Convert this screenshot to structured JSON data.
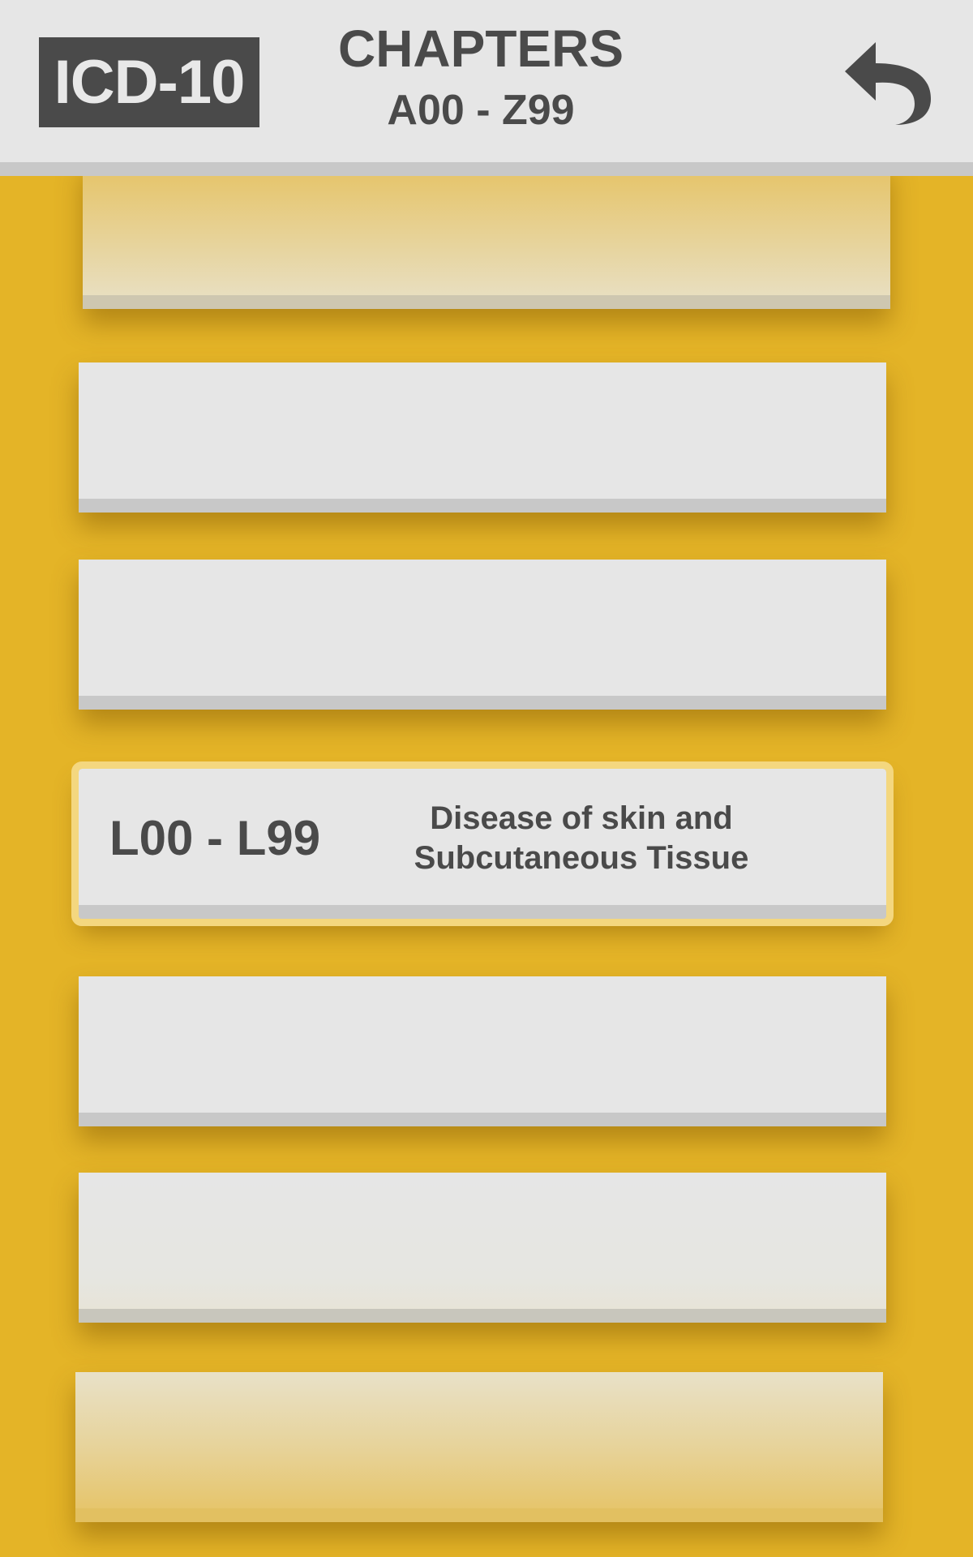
{
  "header": {
    "logo": "ICD-10",
    "title": "CHAPTERS",
    "subtitle": "A00 - Z99",
    "back_icon": "undo-arrow-icon"
  },
  "chapters": [
    {
      "code": "",
      "description": ""
    },
    {
      "code": "",
      "description": ""
    },
    {
      "code": "",
      "description": ""
    },
    {
      "code": "L00 - L99",
      "description": "Disease of skin and Subcutaneous Tissue",
      "selected": true
    },
    {
      "code": "",
      "description": ""
    },
    {
      "code": "",
      "description": ""
    },
    {
      "code": "",
      "description": ""
    }
  ],
  "colors": {
    "background": "#E4B427",
    "header": "#E6E6E6",
    "card": "#E6E6E6",
    "text": "#4A4A4A",
    "highlight": "#F4D77F"
  }
}
